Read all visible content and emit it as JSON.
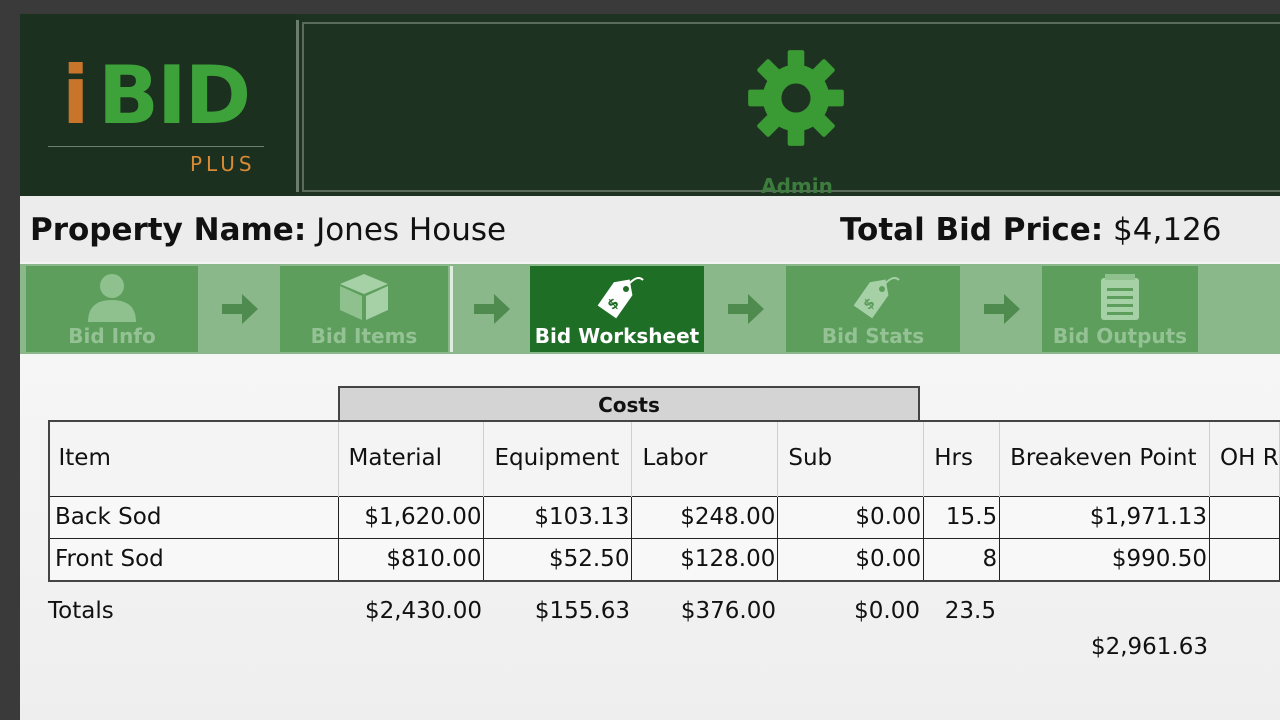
{
  "header": {
    "logo": {
      "i": "i",
      "bid": "BID",
      "plus": "PLUS"
    },
    "admin_center": "Admin Center",
    "colors": {
      "brand_green": "#3ea23a",
      "brand_orange": "#c8742b",
      "header_bg": "#1e3222"
    }
  },
  "property": {
    "name_label": "Property Name:",
    "name_value": "Jones House",
    "bid_label": "Total Bid Price:",
    "bid_value": "$4,126"
  },
  "steps": [
    {
      "label": "Bid Info",
      "icon": "person-icon",
      "active": false
    },
    {
      "label": "Bid Items",
      "icon": "box-icon",
      "active": false
    },
    {
      "label": "Bid Worksheet",
      "icon": "price-tag-icon",
      "active": true
    },
    {
      "label": "Bid Stats",
      "icon": "price-tag-icon",
      "active": false
    },
    {
      "label": "Bid Outputs",
      "icon": "notepad-icon",
      "active": false
    }
  ],
  "table": {
    "group_header": "Costs",
    "columns": [
      "Item",
      "Material",
      "Equipment",
      "Labor",
      "Sub",
      "Hrs",
      "Breakeven Point",
      "OH R"
    ],
    "rows": [
      {
        "item": "Back Sod",
        "material": "$1,620.00",
        "equipment": "$103.13",
        "labor": "$248.00",
        "sub": "$0.00",
        "hrs": "15.5",
        "breakeven": "$1,971.13"
      },
      {
        "item": "Front Sod",
        "material": "$810.00",
        "equipment": "$52.50",
        "labor": "$128.00",
        "sub": "$0.00",
        "hrs": "8",
        "breakeven": "$990.50"
      }
    ],
    "totals": {
      "label": "Totals",
      "material": "$2,430.00",
      "equipment": "$155.63",
      "labor": "$376.00",
      "sub": "$0.00",
      "hrs": "23.5",
      "breakeven": "$2,961.63"
    }
  }
}
